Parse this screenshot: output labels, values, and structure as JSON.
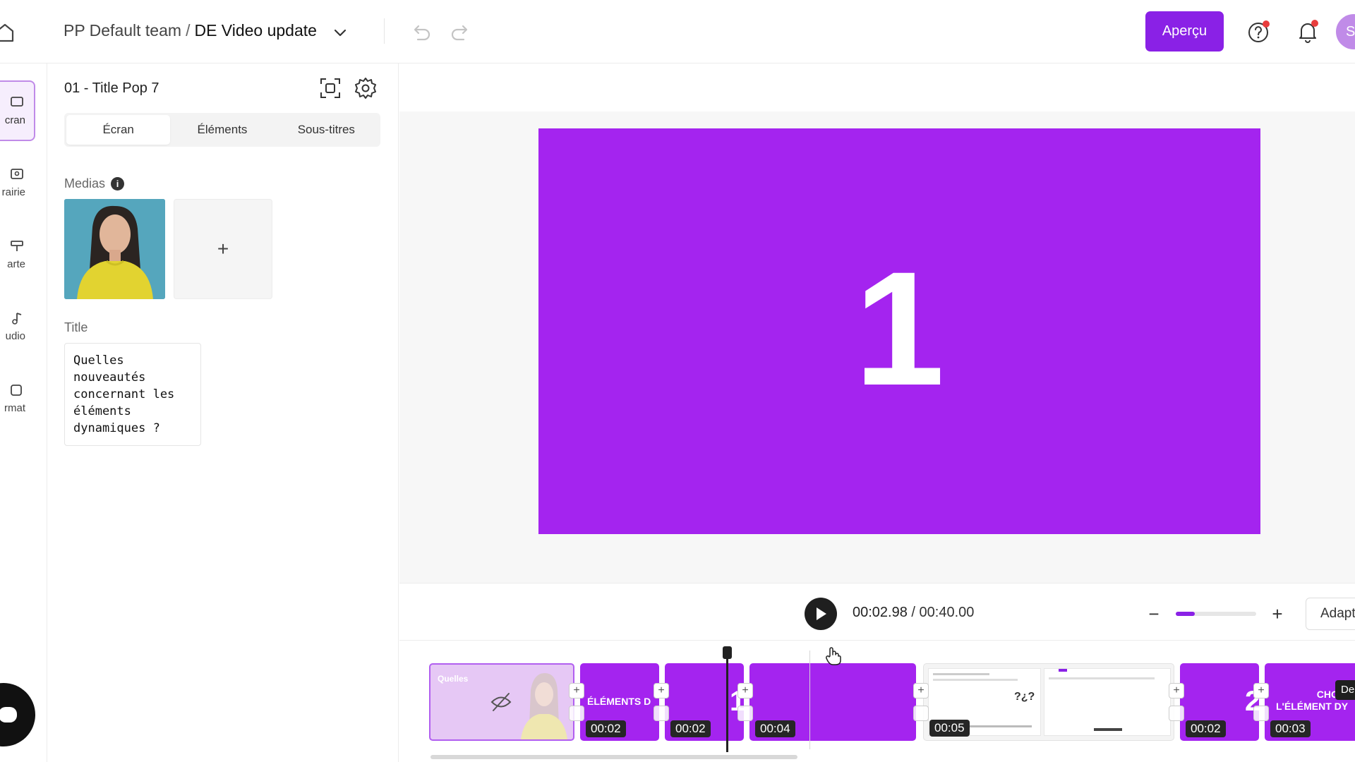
{
  "header": {
    "team": "PP Default team",
    "separator": "/",
    "project": "DE Video update",
    "preview_label": "Aperçu",
    "avatar_initial": "S"
  },
  "rail": {
    "items": [
      {
        "label": "cran",
        "icon": "screen-icon",
        "active": true
      },
      {
        "label": "rairie",
        "icon": "library-icon",
        "active": false
      },
      {
        "label": "arte",
        "icon": "brand-kit-icon",
        "active": false
      },
      {
        "label": "udio",
        "icon": "music-note-icon",
        "active": false
      },
      {
        "label": "rmat",
        "icon": "format-icon",
        "active": false
      }
    ]
  },
  "panel": {
    "scene_title": "01 - Title Pop 7",
    "tabs": [
      {
        "label": "Écran",
        "active": true
      },
      {
        "label": "Éléments",
        "active": false
      },
      {
        "label": "Sous-titres",
        "active": false
      }
    ],
    "medias_label": "Medias",
    "medias_info": "i",
    "media_add": "+",
    "title_label": "Title",
    "title_value": "Quelles\nnouveautés\nconcernant les\néléments\ndynamiques ?"
  },
  "canvas": {
    "slide_text": "1",
    "slide_color": "#a424ef"
  },
  "player": {
    "current_time": "00:02.98",
    "separator": " / ",
    "total_time": "00:40.00",
    "zoom_minus": "−",
    "zoom_plus": "+",
    "zoom_level": 0.24,
    "fit_label": "Adapter"
  },
  "timeline": {
    "clips": [
      {
        "duration": "",
        "caption": "Quelles",
        "hidden": true
      },
      {
        "duration": "00:02",
        "caption": "ÉLÉMENTS D"
      },
      {
        "duration": "00:02",
        "caption": "1"
      },
      {
        "duration": "00:04",
        "caption": ""
      },
      {
        "duration": "00:05",
        "caption": "?¿?"
      },
      {
        "duration": "00:02",
        "caption": "2"
      },
      {
        "duration": "00:03",
        "caption": "CHOIS\nL'ÉLÉMENT DY"
      }
    ],
    "add_symbol": "+",
    "tooltip": "De"
  },
  "colors": {
    "accent": "#8a21e6",
    "slide": "#a424ef",
    "notification": "#e83d3d"
  }
}
